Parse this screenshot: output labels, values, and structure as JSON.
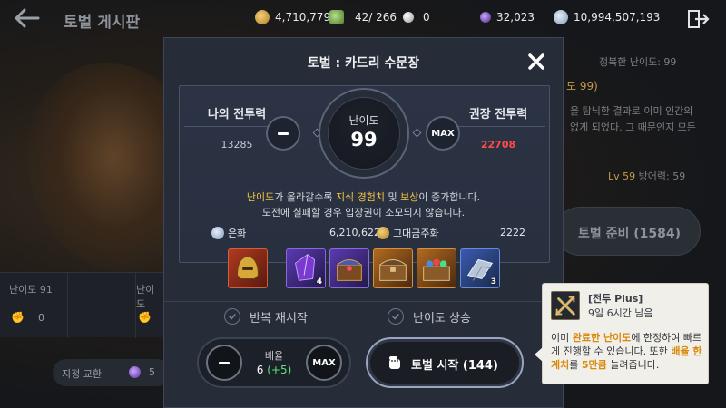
{
  "topbar": {
    "title": "토벌 게시판",
    "resources": [
      {
        "icon": "gold-coin-icon",
        "value": "4,710,779",
        "color": "#d4a23a"
      },
      {
        "icon": "stamina-icon",
        "value": "42/ 266",
        "color": "#6aa84f"
      },
      {
        "icon": "pearl-icon",
        "value": "0",
        "color": "#d9d9d9"
      },
      {
        "icon": "dark-orb-icon",
        "value": "32,023",
        "color": "#6b3fb5"
      },
      {
        "icon": "silver-coin-icon",
        "value": "10,994,507,193",
        "color": "#9fb3d1"
      }
    ]
  },
  "background": {
    "conquered_difficulty": "정복한 난이도: 99",
    "partial_difficulty": "도 99)",
    "desc1": "을 탐닉한 결과로 이미 인간의",
    "desc2": "없게 되었다. 그 때문인지 모든",
    "lv_text": "Lv 59",
    "defense_text": "방어력: 59",
    "ready_button": "토벌 준비 (1584)",
    "card_left_label": "난이도 91",
    "card_left_count": "0",
    "card_right_label": "난이도",
    "exchange_label": "지정 교환",
    "exchange_count": "5"
  },
  "modal": {
    "title": "토벌 : 카드리 수문장",
    "my_power_label": "나의 전투력",
    "my_power_value": "13285",
    "recommended_label": "권장 전투력",
    "recommended_value": "22708",
    "difficulty_label": "난이도",
    "difficulty_value": "99",
    "max_label": "MAX",
    "info_line1_parts": {
      "a": "난이도",
      "b": "가 올라갈수록 ",
      "c": "지식 경험치",
      "d": " 및 ",
      "e": "보상",
      "f": "이 증가합니다."
    },
    "info_line2": "도전에 실패할 경우 입장권이 소모되지 않습니다.",
    "currencies": [
      {
        "icon": "silver-coin-icon",
        "label": "은화",
        "value": "6,210,622"
      },
      {
        "icon": "ancient-gold-coin-icon",
        "label": "고대금주화",
        "value": "2222"
      }
    ],
    "rewards": [
      {
        "icon": "golden-helmet-icon",
        "count": "",
        "color": "#8a2a1a"
      },
      {
        "icon": "purple-crystal-icon",
        "count": "4",
        "color": "#3a2a6a"
      },
      {
        "icon": "jewel-chest-icon",
        "count": "",
        "color": "#3a2a6a"
      },
      {
        "icon": "treasure-chest-icon",
        "count": "",
        "color": "#8a4a1a"
      },
      {
        "icon": "gem-chest-icon",
        "count": "",
        "color": "#8a4a1a"
      },
      {
        "icon": "silver-ingot-icon",
        "count": "3",
        "color": "#2a3a6a"
      }
    ],
    "toggle_repeat": "반복 재시작",
    "toggle_difficulty_up": "난이도 상승"
  },
  "bottom": {
    "multiplier_label": "배율",
    "multiplier_value": "6",
    "multiplier_bonus": "(+5)",
    "max_label": "MAX",
    "start_label": "토벌 시작 (144)"
  },
  "buff": {
    "title": "[전투 Plus]",
    "remaining": "9일 6시간 남음",
    "desc_parts": {
      "a": "이미 ",
      "b": "완료한 난이도",
      "c": "에 한정하여 빠르게 진행할 수 있습니다. 또한 ",
      "d": "배율 한계치",
      "e": "를 ",
      "f": "5만큼",
      "g": " 늘려줍니다."
    }
  }
}
